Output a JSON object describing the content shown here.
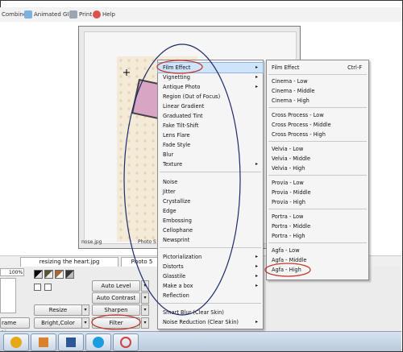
{
  "topbar": {
    "combine": "Combine",
    "animated_gif": "Animated GIF",
    "print": "Print",
    "help": "Help"
  },
  "thumbs": {
    "left_caption": "nose.jpg",
    "right_caption": "Photo S"
  },
  "tabs": {
    "current_file": "resizing the heart.jpg",
    "other_file": "Photo 5"
  },
  "controls": {
    "zoom": "100%",
    "auto_level": "Auto Level",
    "auto_contrast": "Auto Contrast",
    "resize": "Resize",
    "sharpen": "Sharpen",
    "bright_color": "Bright,Color",
    "filter": "Filter",
    "frame_line": "rame Line"
  },
  "filter_menu": {
    "items": [
      "Film Effect",
      "Vignetting",
      "Antique Photo",
      "Region (Out of Focus)",
      "Linear Gradient",
      "Graduated Tint",
      "Fake Tilt-Shift",
      "Lens Flare",
      "Fade Style",
      "Blur",
      "Texture",
      "Noise",
      "Jitter",
      "Crystallize",
      "Edge",
      "Embossing",
      "Cellophane",
      "Newsprint",
      "Pictorialization",
      "Distorts",
      "Glasstile",
      "Make a box",
      "Reflection",
      "Smart Blur (Clear Skin)",
      "Noise Reduction (Clear Skin)"
    ]
  },
  "film_menu": {
    "film_effect": "Film Effect",
    "film_effect_shortcut": "Ctrl-F",
    "items": [
      "Cinema - Low",
      "Cinema - Middle",
      "Cinema - High",
      "Cross Process - Low",
      "Cross Process - Middle",
      "Cross Process - High",
      "Velvia - Low",
      "Velvia - Middle",
      "Velvia - High",
      "Provia - Low",
      "Provia - Middle",
      "Provia - High",
      "Portra - Low",
      "Portra - Middle",
      "Portra - High",
      "Agfa - Low",
      "Agfa - Middle",
      "Agfa - High"
    ]
  },
  "colors": {
    "annotation": "#c0392b",
    "highlight": "#cfe3fb",
    "oval": "#1f2a6b"
  }
}
